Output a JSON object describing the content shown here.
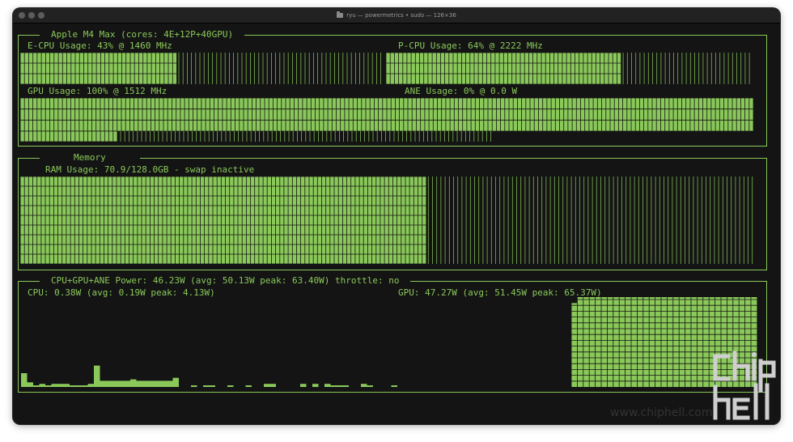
{
  "window": {
    "title": "ryu — powermetrics • sudo — 126×36"
  },
  "colors": {
    "accent": "#8ac85a",
    "background": "#141414",
    "dim_track": "#8ac85a"
  },
  "cpu_panel": {
    "title": "Apple M4 Max (cores: 4E+12P+40GPU)",
    "ecpu_label": "E-CPU Usage: 43% @ 1460 MHz",
    "ecpu_percent": 43,
    "pcpu_label": "P-CPU Usage: 64% @ 2222 MHz",
    "pcpu_percent": 64,
    "gpu_label": "GPU Usage: 100% @ 1512 MHz",
    "gpu_percent": 100,
    "ane_label": "ANE Usage: 0% @ 0.0 W",
    "ane_percent": 0
  },
  "memory_panel": {
    "title": "Memory",
    "ram_label": "RAM Usage: 70.9/128.0GB - swap inactive",
    "ram_used_gb": 70.9,
    "ram_total_gb": 128.0
  },
  "power_panel": {
    "title": "CPU+GPU+ANE Power: 46.23W (avg: 50.13W peak: 63.40W) throttle: no",
    "cpu_label": "CPU: 0.38W (avg: 0.19W peak: 4.13W)",
    "gpu_label": "GPU: 47.27W (avg: 51.45W peak: 65.37W)"
  },
  "chart_data": {
    "type": "area",
    "series": [
      {
        "name": "CPU",
        "values": [
          0.9,
          0.3,
          0.1,
          0.2,
          0.1,
          0.2,
          0.2,
          0.2,
          0.1,
          0.1,
          0.1,
          0.2,
          1.4,
          0.4,
          0.4,
          0.4,
          0.4,
          0.4,
          0.5,
          0.4,
          0.4,
          0.4,
          0.4,
          0.4,
          0.4,
          0.6,
          0,
          0,
          0.1,
          0,
          0.1,
          0.1,
          0,
          0,
          0.1,
          0,
          0,
          0.1,
          0,
          0,
          0.2,
          0.2,
          0,
          0,
          0,
          0,
          0.2,
          0,
          0.2,
          0,
          0.2,
          0.1,
          0.1,
          0.1,
          0,
          0,
          0.2,
          0.1,
          0,
          0,
          0,
          0.1,
          0
        ],
        "max": 4.13
      },
      {
        "name": "GPU",
        "values": [
          61,
          65.37,
          65.37,
          65.37,
          65.37,
          65.37,
          65.37,
          65.37,
          65.37,
          65.37,
          65.37,
          65.37,
          65.37,
          65.37,
          65.37,
          65.37,
          65.37,
          65.37,
          65.37,
          65.37,
          65.37,
          65.37,
          65.37,
          65.37,
          65.37,
          65.37,
          65.37,
          65.37,
          65.37,
          65.37,
          65.37
        ],
        "max": 65.37
      }
    ]
  }
}
